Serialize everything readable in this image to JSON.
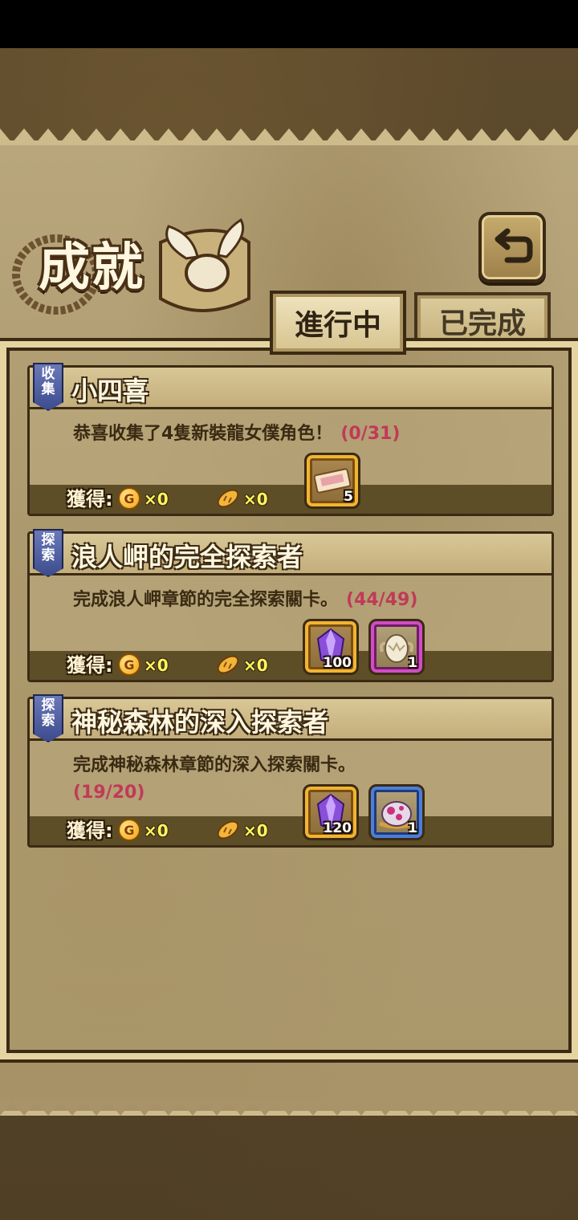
{
  "screen": {
    "title": "成就",
    "back_icon": "return-arrow-icon"
  },
  "tabs": [
    {
      "label": "進行中",
      "active": true
    },
    {
      "label": "已完成",
      "active": false
    }
  ],
  "reward_label": "獲得:",
  "achievements": [
    {
      "category": "收集",
      "category_chars": [
        "收",
        "集"
      ],
      "title": "小四喜",
      "description": "恭喜收集了4隻新裝龍女僕角色！",
      "progress": "(0/31)",
      "gold": "×0",
      "bread": "×0",
      "rewards": [
        {
          "icon": "ticket-icon",
          "qty": "5",
          "rarity": "gold"
        }
      ]
    },
    {
      "category": "探索",
      "category_chars": [
        "探",
        "索"
      ],
      "title": "浪人岬的完全探索者",
      "description": "完成浪人岬章節的完全探索關卡。",
      "progress": "(44/49)",
      "gold": "×0",
      "bread": "×0",
      "rewards": [
        {
          "icon": "purple-crystal-icon",
          "qty": "100",
          "rarity": "gold"
        },
        {
          "icon": "white-egg-icon",
          "qty": "1",
          "rarity": "epic"
        }
      ]
    },
    {
      "category": "探索",
      "category_chars": [
        "探",
        "索"
      ],
      "title": "神秘森林的深入探索者",
      "description": "完成神秘森林章節的深入探索關卡。",
      "progress": "(19/20)",
      "gold": "×0",
      "bread": "×0",
      "rewards": [
        {
          "icon": "purple-crystal-icon",
          "qty": "120",
          "rarity": "gold"
        },
        {
          "icon": "spotted-egg-icon",
          "qty": "1",
          "rarity": "rare"
        }
      ]
    }
  ],
  "colors": {
    "progress": "#c03a59",
    "parchment": "#b9a67c",
    "frame_dark": "#3b2a14"
  }
}
